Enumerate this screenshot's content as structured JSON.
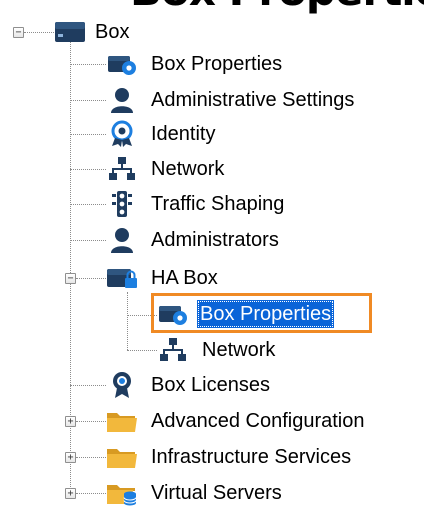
{
  "cropped_header": "Box Properties",
  "tree": {
    "root": {
      "label": "Box",
      "icon": "server-box-icon",
      "expanded": true
    },
    "items": [
      {
        "label": "Box Properties",
        "icon": "box-settings-icon"
      },
      {
        "label": "Administrative Settings",
        "icon": "admin-user-icon"
      },
      {
        "label": "Identity",
        "icon": "identity-badge-icon"
      },
      {
        "label": "Network",
        "icon": "network-icon"
      },
      {
        "label": "Traffic Shaping",
        "icon": "traffic-light-icon"
      },
      {
        "label": "Administrators",
        "icon": "admin-user-icon"
      },
      {
        "label": "HA Box",
        "icon": "locked-box-icon",
        "expanded": true
      },
      {
        "label": "Box Properties",
        "icon": "box-settings-icon",
        "selected": true
      },
      {
        "label": "Network",
        "icon": "network-icon"
      },
      {
        "label": "Box Licenses",
        "icon": "license-medal-icon"
      },
      {
        "label": "Advanced Configuration",
        "icon": "folder-icon",
        "expanded": false
      },
      {
        "label": "Infrastructure Services",
        "icon": "folder-icon",
        "expanded": false
      },
      {
        "label": "Virtual Servers",
        "icon": "folder-database-icon",
        "expanded": false
      }
    ]
  },
  "colors": {
    "icon_dark": "#1f3c5f",
    "icon_gear": "#1d7fe0",
    "folder": "#f2b83c",
    "selection": "#0a64d8",
    "highlight_border": "#f08a24"
  }
}
